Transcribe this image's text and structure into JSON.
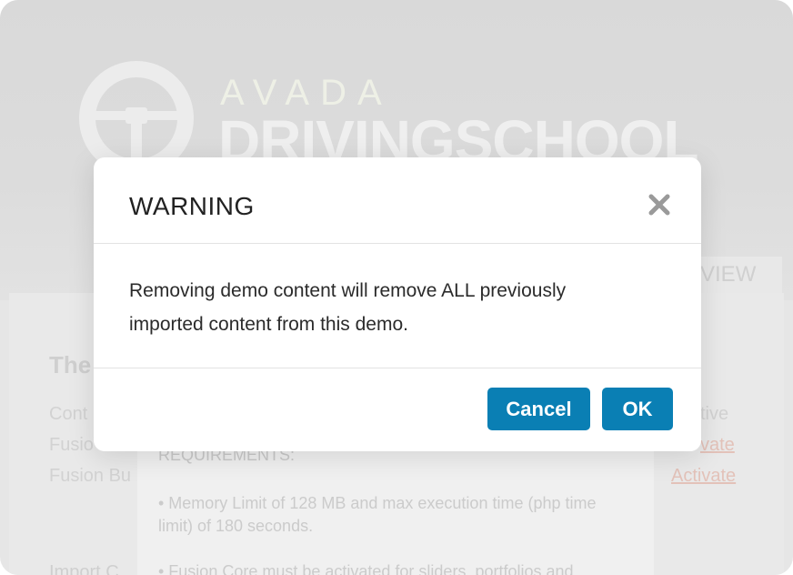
{
  "background": {
    "brand_small": "AVADA",
    "brand_big": "DRIVINGSCHOOL",
    "preview_tab": "EVIEW",
    "theme_title": "The",
    "rows": [
      {
        "label": "Cont",
        "status": "ctive"
      },
      {
        "label": "Fusio",
        "status": "vate"
      },
      {
        "label": "Fusion Bu",
        "status": "Activate"
      }
    ],
    "requirements_heading": "REQUIREMENTS:",
    "requirements": [
      "• Memory Limit of 128 MB and max execution time (php time limit) of 180 seconds.",
      "• Fusion Core must be activated for sliders, portfolios and"
    ],
    "import_label": "Import C"
  },
  "modal": {
    "title": "WARNING",
    "close_icon": "close-icon",
    "message": "Removing demo content will remove ALL previously imported content from this demo.",
    "cancel_label": "Cancel",
    "ok_label": "OK"
  },
  "colors": {
    "accent": "#0a7fb4",
    "title_text": "#222222",
    "overlay_bg": "#e6e6e6"
  }
}
